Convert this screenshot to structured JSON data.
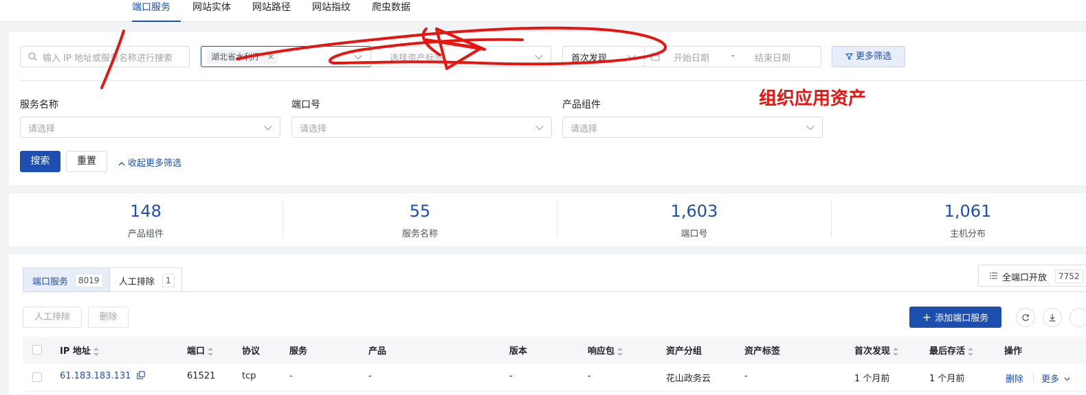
{
  "nav": {
    "tabs": [
      {
        "label": "端口服务",
        "active": true
      },
      {
        "label": "网站实体"
      },
      {
        "label": "网站路径"
      },
      {
        "label": "网站指纹"
      },
      {
        "label": "爬虫数据"
      }
    ]
  },
  "filters": {
    "search_placeholder": "输入 IP 地址或服务名称进行搜索",
    "org_tag": "湖北省水利厅",
    "asset_tag_placeholder": "选择资产标签",
    "date_type": "首次发现",
    "start_date_placeholder": "开始日期",
    "date_separator": "-",
    "end_date_placeholder": "结束日期",
    "more_filter_label": "更多筛选",
    "service_name_label": "服务名称",
    "port_label": "端口号",
    "component_label": "产品组件",
    "select_placeholder": "请选择",
    "search_button": "搜索",
    "reset_button": "重置",
    "collapse_label": "收起更多筛选"
  },
  "annotation": {
    "text": "组织应用资产",
    "color": "#e8140f"
  },
  "stats": [
    {
      "value": "148",
      "label": "产品组件"
    },
    {
      "value": "55",
      "label": "服务名称"
    },
    {
      "value": "1,603",
      "label": "端口号"
    },
    {
      "value": "1,061",
      "label": "主机分布"
    }
  ],
  "list": {
    "tabs": [
      {
        "label": "端口服务",
        "count": "8019",
        "active": true
      },
      {
        "label": "人工排除",
        "count": "1"
      }
    ],
    "full_port_label": "全端口开放",
    "full_port_count": "7752",
    "exclude_button": "人工排除",
    "delete_button": "删除",
    "add_button": "添加端口服务",
    "columns": [
      "IP 地址",
      "端口",
      "协议",
      "服务",
      "产品",
      "版本",
      "响应包",
      "资产分组",
      "资产标签",
      "首次发现",
      "最后存活",
      "操作"
    ],
    "rows": [
      {
        "ip": "61.183.183.131",
        "port": "61521",
        "protocol": "tcp",
        "service": "-",
        "product": "-",
        "version": "-",
        "response": "-",
        "group": "花山政务云",
        "tag": "-",
        "first_seen": "1 个月前",
        "last_alive": "1 个月前",
        "action_delete": "删除",
        "action_more": "更多"
      }
    ]
  },
  "colors": {
    "primary": "#1d4fb0",
    "annotation_red": "#e8140f"
  }
}
